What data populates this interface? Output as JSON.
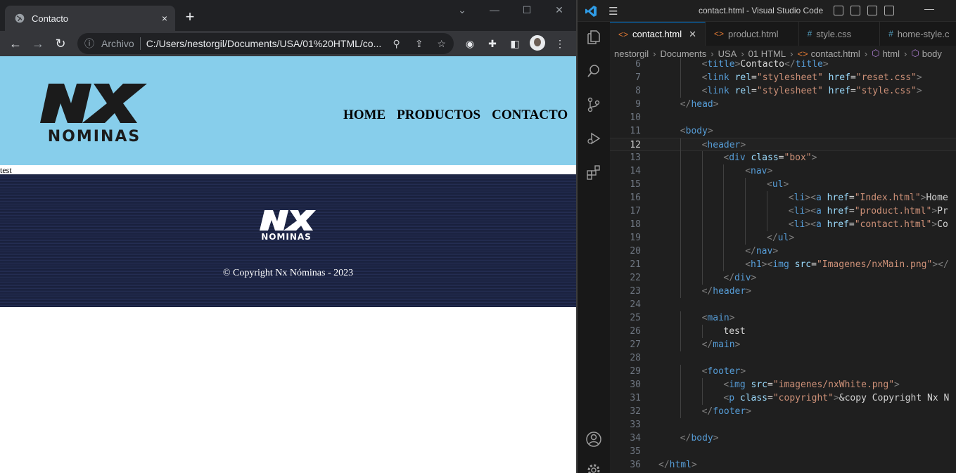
{
  "browser": {
    "tab_title": "Contacto",
    "tab_close": "×",
    "new_tab": "+",
    "window_controls": {
      "tabsearch": "⌄",
      "minimize": "—",
      "maximize": "☐",
      "close": "✕"
    },
    "address": {
      "scheme_label": "Archivo",
      "url": "C:/Users/nestorgil/Documents/USA/01%20HTML/co..."
    }
  },
  "website": {
    "header_bg": "#87ceeb",
    "logo_text": "NOMINAS",
    "nav": [
      "HOME",
      "PRODUCTOS",
      "CONTACTO"
    ],
    "main_text": "test",
    "footer_logo_text": "NOMINAS",
    "copyright": "© Copyright Nx Nóminas - 2023"
  },
  "vscode": {
    "title": "contact.html - Visual Studio Code",
    "tabs": [
      {
        "label": "contact.html",
        "icon": "<>",
        "active": true,
        "close": "✕"
      },
      {
        "label": "product.html",
        "icon": "<>",
        "active": false
      },
      {
        "label": "style.css",
        "icon": "#",
        "active": false
      },
      {
        "label": "home-style.c",
        "icon": "#",
        "active": false
      }
    ],
    "breadcrumb": [
      "nestorgil",
      "Documents",
      "USA",
      "01 HTML",
      "contact.html",
      "html",
      "body"
    ],
    "current_line": 12,
    "lines": [
      {
        "n": "6",
        "indent": 2,
        "parts": [
          [
            "pn",
            "<"
          ],
          [
            "tg",
            "title"
          ],
          [
            "pn",
            ">"
          ],
          [
            "tx",
            "Contacto"
          ],
          [
            "pn",
            "</"
          ],
          [
            "tg",
            "title"
          ],
          [
            "pn",
            ">"
          ]
        ]
      },
      {
        "n": "7",
        "indent": 2,
        "parts": [
          [
            "pn",
            "<"
          ],
          [
            "tg",
            "link "
          ],
          [
            "at",
            "rel"
          ],
          [
            "tx",
            "="
          ],
          [
            "st",
            "\"stylesheet\" "
          ],
          [
            "at",
            "href"
          ],
          [
            "tx",
            "="
          ],
          [
            "st",
            "\"reset.css\""
          ],
          [
            "pn",
            ">"
          ]
        ]
      },
      {
        "n": "8",
        "indent": 2,
        "parts": [
          [
            "pn",
            "<"
          ],
          [
            "tg",
            "link "
          ],
          [
            "at",
            "rel"
          ],
          [
            "tx",
            "="
          ],
          [
            "st",
            "\"stylesheet\" "
          ],
          [
            "at",
            "href"
          ],
          [
            "tx",
            "="
          ],
          [
            "st",
            "\"style.css\""
          ],
          [
            "pn",
            ">"
          ]
        ]
      },
      {
        "n": "9",
        "indent": 1,
        "parts": [
          [
            "pn",
            "</"
          ],
          [
            "tg",
            "head"
          ],
          [
            "pn",
            ">"
          ]
        ]
      },
      {
        "n": "10",
        "indent": 0,
        "parts": []
      },
      {
        "n": "11",
        "indent": 1,
        "parts": [
          [
            "pn",
            "<"
          ],
          [
            "tg",
            "body"
          ],
          [
            "pn",
            ">"
          ]
        ]
      },
      {
        "n": "12",
        "indent": 2,
        "parts": [
          [
            "pn",
            "<"
          ],
          [
            "tg",
            "header"
          ],
          [
            "pn",
            ">"
          ]
        ]
      },
      {
        "n": "13",
        "indent": 3,
        "parts": [
          [
            "pn",
            "<"
          ],
          [
            "tg",
            "div "
          ],
          [
            "at",
            "class"
          ],
          [
            "tx",
            "="
          ],
          [
            "st",
            "\"box\""
          ],
          [
            "pn",
            ">"
          ]
        ]
      },
      {
        "n": "14",
        "indent": 4,
        "parts": [
          [
            "pn",
            "<"
          ],
          [
            "tg",
            "nav"
          ],
          [
            "pn",
            ">"
          ]
        ]
      },
      {
        "n": "15",
        "indent": 5,
        "parts": [
          [
            "pn",
            "<"
          ],
          [
            "tg",
            "ul"
          ],
          [
            "pn",
            ">"
          ]
        ]
      },
      {
        "n": "16",
        "indent": 6,
        "parts": [
          [
            "pn",
            "<"
          ],
          [
            "tg",
            "li"
          ],
          [
            "pn",
            "><"
          ],
          [
            "tg",
            "a "
          ],
          [
            "at",
            "href"
          ],
          [
            "tx",
            "="
          ],
          [
            "st",
            "\"Index.html\""
          ],
          [
            "pn",
            ">"
          ],
          [
            "tx",
            "Home"
          ]
        ]
      },
      {
        "n": "17",
        "indent": 6,
        "parts": [
          [
            "pn",
            "<"
          ],
          [
            "tg",
            "li"
          ],
          [
            "pn",
            "><"
          ],
          [
            "tg",
            "a "
          ],
          [
            "at",
            "href"
          ],
          [
            "tx",
            "="
          ],
          [
            "st",
            "\"product.html\""
          ],
          [
            "pn",
            ">"
          ],
          [
            "tx",
            "Pr"
          ]
        ]
      },
      {
        "n": "18",
        "indent": 6,
        "parts": [
          [
            "pn",
            "<"
          ],
          [
            "tg",
            "li"
          ],
          [
            "pn",
            "><"
          ],
          [
            "tg",
            "a "
          ],
          [
            "at",
            "href"
          ],
          [
            "tx",
            "="
          ],
          [
            "st",
            "\"contact.html\""
          ],
          [
            "pn",
            ">"
          ],
          [
            "tx",
            "Co"
          ]
        ]
      },
      {
        "n": "19",
        "indent": 5,
        "parts": [
          [
            "pn",
            "</"
          ],
          [
            "tg",
            "ul"
          ],
          [
            "pn",
            ">"
          ]
        ]
      },
      {
        "n": "20",
        "indent": 4,
        "parts": [
          [
            "pn",
            "</"
          ],
          [
            "tg",
            "nav"
          ],
          [
            "pn",
            ">"
          ]
        ]
      },
      {
        "n": "21",
        "indent": 4,
        "parts": [
          [
            "pn",
            "<"
          ],
          [
            "tg",
            "h1"
          ],
          [
            "pn",
            "><"
          ],
          [
            "tg",
            "img "
          ],
          [
            "at",
            "src"
          ],
          [
            "tx",
            "="
          ],
          [
            "st",
            "\"Imagenes/nxMain.png\""
          ],
          [
            "pn",
            "></"
          ]
        ]
      },
      {
        "n": "22",
        "indent": 3,
        "parts": [
          [
            "pn",
            "</"
          ],
          [
            "tg",
            "div"
          ],
          [
            "pn",
            ">"
          ]
        ]
      },
      {
        "n": "23",
        "indent": 2,
        "parts": [
          [
            "pn",
            "</"
          ],
          [
            "tg",
            "header"
          ],
          [
            "pn",
            ">"
          ]
        ]
      },
      {
        "n": "24",
        "indent": 0,
        "parts": []
      },
      {
        "n": "25",
        "indent": 2,
        "parts": [
          [
            "pn",
            "<"
          ],
          [
            "tg",
            "main"
          ],
          [
            "pn",
            ">"
          ]
        ]
      },
      {
        "n": "26",
        "indent": 3,
        "parts": [
          [
            "tx",
            "test"
          ]
        ]
      },
      {
        "n": "27",
        "indent": 2,
        "parts": [
          [
            "pn",
            "</"
          ],
          [
            "tg",
            "main"
          ],
          [
            "pn",
            ">"
          ]
        ]
      },
      {
        "n": "28",
        "indent": 0,
        "parts": []
      },
      {
        "n": "29",
        "indent": 2,
        "parts": [
          [
            "pn",
            "<"
          ],
          [
            "tg",
            "footer"
          ],
          [
            "pn",
            ">"
          ]
        ]
      },
      {
        "n": "30",
        "indent": 3,
        "parts": [
          [
            "pn",
            "<"
          ],
          [
            "tg",
            "img "
          ],
          [
            "at",
            "src"
          ],
          [
            "tx",
            "="
          ],
          [
            "st",
            "\"imagenes/nxWhite.png\""
          ],
          [
            "pn",
            ">"
          ]
        ]
      },
      {
        "n": "31",
        "indent": 3,
        "parts": [
          [
            "pn",
            "<"
          ],
          [
            "tg",
            "p "
          ],
          [
            "at",
            "class"
          ],
          [
            "tx",
            "="
          ],
          [
            "st",
            "\"copyright\""
          ],
          [
            "pn",
            ">"
          ],
          [
            "tx",
            "&copy Copyright Nx N"
          ]
        ]
      },
      {
        "n": "32",
        "indent": 2,
        "parts": [
          [
            "pn",
            "</"
          ],
          [
            "tg",
            "footer"
          ],
          [
            "pn",
            ">"
          ]
        ]
      },
      {
        "n": "33",
        "indent": 0,
        "parts": []
      },
      {
        "n": "34",
        "indent": 1,
        "parts": [
          [
            "pn",
            "</"
          ],
          [
            "tg",
            "body"
          ],
          [
            "pn",
            ">"
          ]
        ]
      },
      {
        "n": "35",
        "indent": 0,
        "parts": []
      },
      {
        "n": "36",
        "indent": 0,
        "parts": [
          [
            "pn",
            "</"
          ],
          [
            "tg",
            "html"
          ],
          [
            "pn",
            ">"
          ]
        ]
      }
    ]
  }
}
